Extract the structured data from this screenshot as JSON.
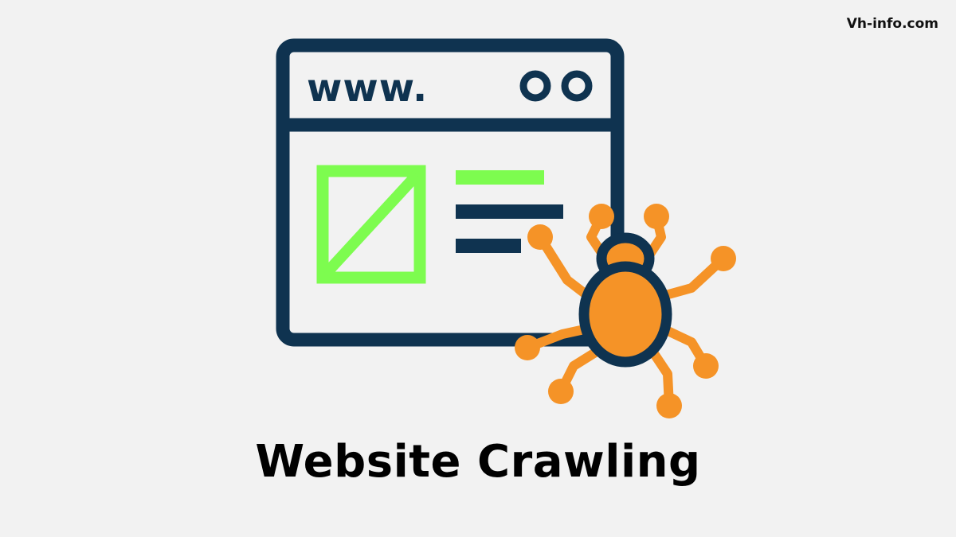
{
  "site": {
    "domain": "Vh-info.com"
  },
  "illustration": {
    "url_text": "www.",
    "icons": [
      "browser-window-icon",
      "image-placeholder-icon",
      "text-lines-icon",
      "window-dots-icon",
      "spider-bug-icon"
    ],
    "colors": {
      "navy": "#0f3350",
      "green": "#7dfc4f",
      "orange": "#f59327",
      "background": "#f2f2f2"
    }
  },
  "headline": {
    "text": "Website Crawling"
  }
}
